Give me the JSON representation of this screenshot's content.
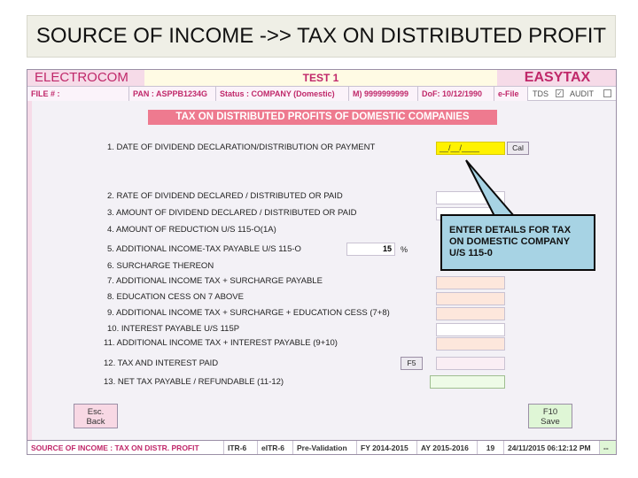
{
  "slide": {
    "title": "SOURCE OF INCOME ->> TAX ON DISTRIBUTED PROFIT"
  },
  "topbar": {
    "brand_left": "ELECTROCOM",
    "center": "TEST 1",
    "brand_right": "EASYTAX"
  },
  "infobar": {
    "file": "FILE # :",
    "pan": "PAN : ASPPB1234G",
    "status": "Status : COMPANY (Domestic)",
    "mobile": "M) 9999999999",
    "dof": "DoF: 10/12/1990",
    "efile": "e-File",
    "tds": "TDS",
    "tds_checked": "✓",
    "audit": "AUDIT"
  },
  "form": {
    "heading": "TAX ON DISTRIBUTED PROFITS OF DOMESTIC COMPANIES",
    "date_value": "__/__/____",
    "cal_label": "Cal",
    "rows": {
      "r1": "1.  DATE OF DIVIDEND DECLARATION/DISTRIBUTION OR PAYMENT",
      "r2": "2.  RATE OF DIVIDEND DECLARED / DISTRIBUTED OR PAID",
      "r3": "3.  AMOUNT OF DIVIDEND DECLARED / DISTRIBUTED OR PAID",
      "r4": "4.  AMOUNT OF REDUCTION U/S 115-O(1A)",
      "r5": "5.  ADDITIONAL INCOME-TAX PAYABLE U/S 115-O",
      "r6": "6.  SURCHARGE THEREON",
      "r7": "7.  ADDITIONAL INCOME TAX + SURCHARGE PAYABLE",
      "r8": "8.  EDUCATION CESS ON 7 ABOVE",
      "r9": "9.  ADDITIONAL INCOME TAX + SURCHARGE + EDUCATION CESS (7+8)",
      "r10": "10.  INTEREST PAYABLE U/S 115P",
      "r11": "11.  ADDITIONAL INCOME TAX + INTEREST PAYABLE (9+10)",
      "r12": "12.  TAX AND INTEREST PAID",
      "r13": "13.  NET TAX PAYABLE / REFUNDABLE (11-12)"
    },
    "rate_value": "15",
    "rate_unit": "%",
    "f5_label": "F5"
  },
  "buttons": {
    "esc_line1": "Esc.",
    "esc_line2": "Back",
    "save_line1": "F10",
    "save_line2": "Save"
  },
  "callout": {
    "text": "ENTER DETAILS FOR TAX ON DOMESTIC COMPANY U/S 115-0"
  },
  "statusbar": {
    "source": "SOURCE OF INCOME : TAX ON DISTR. PROFIT",
    "itr": "ITR-6",
    "eitr": "eITR-6",
    "prevalidation": "Pre-Validation",
    "fy": "FY 2014-2015",
    "ay": "AY 2015-2016",
    "count": "19",
    "datetime": "24/11/2015 06:12:12 PM",
    "dash": "--"
  },
  "colors": {
    "accent": "#c0286a",
    "heading_bg": "#ee7a8f",
    "callout_bg": "#a7d3e4",
    "date_field": "#fff200"
  }
}
